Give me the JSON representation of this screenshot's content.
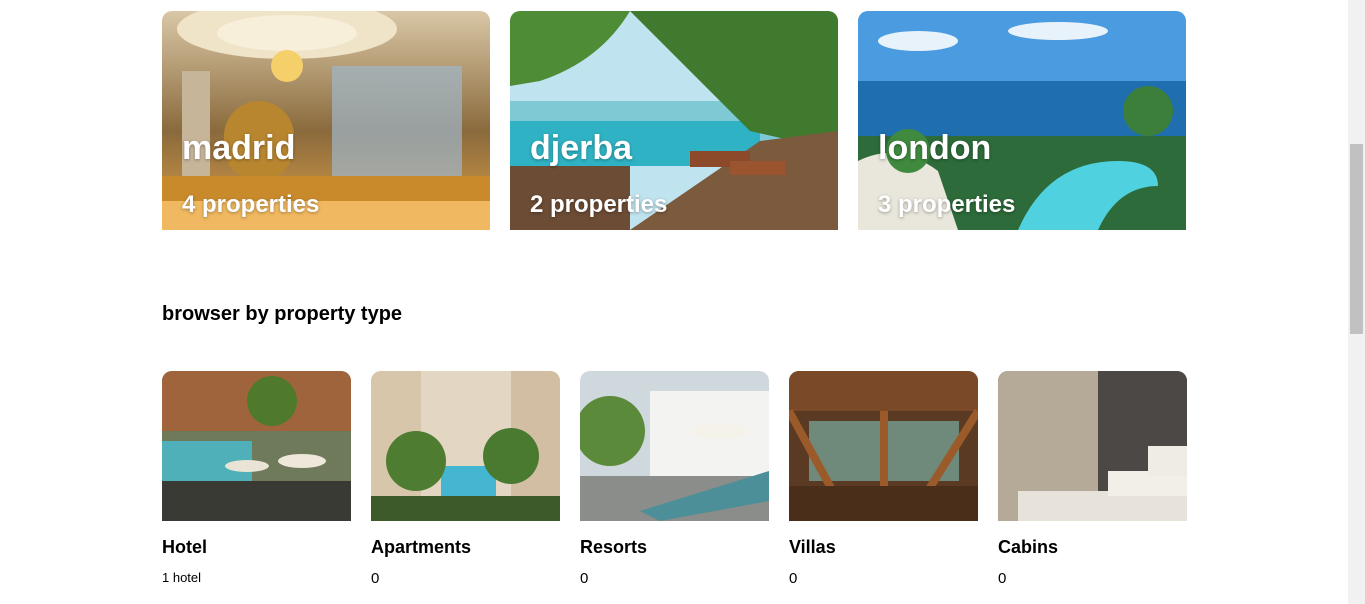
{
  "featured": [
    {
      "city": "madrid",
      "count": "4 properties",
      "image": "hotel-lobby-photo"
    },
    {
      "city": "djerba",
      "count": "2 properties",
      "image": "pool-deck-photo"
    },
    {
      "city": "london",
      "count": "3 properties",
      "image": "ocean-resort-photo"
    }
  ],
  "section_title": "browser by property type",
  "property_types": [
    {
      "name": "Hotel",
      "count": "1 hotel",
      "image": "hotel-pool-photo"
    },
    {
      "name": "Apartments",
      "count": "0",
      "image": "apartment-courtyard-photo"
    },
    {
      "name": "Resorts",
      "count": "0",
      "image": "resort-loungers-photo"
    },
    {
      "name": "Villas",
      "count": "0",
      "image": "villa-patio-photo"
    },
    {
      "name": "Cabins",
      "count": "0",
      "image": "cabin-bedroom-photo"
    }
  ]
}
